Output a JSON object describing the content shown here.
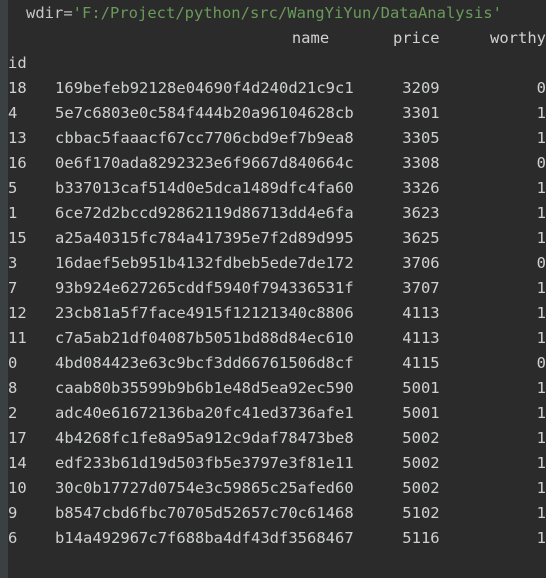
{
  "console": {
    "wdir_line": {
      "var": "wdir",
      "operator": "=",
      "path": "'F:/Project/python/src/WangYiYun/DataAnalysis'"
    },
    "index_name": "id",
    "columns": [
      "name",
      "price",
      "worthy"
    ],
    "rows": [
      {
        "id": "18",
        "name": "169befeb92128e04690f4d240d21c9c1",
        "price": "3209",
        "worthy": "0"
      },
      {
        "id": "4",
        "name": "5e7c6803e0c584f444b20a96104628cb",
        "price": "3301",
        "worthy": "1"
      },
      {
        "id": "13",
        "name": "cbbac5faaacf67cc7706cbd9ef7b9ea8",
        "price": "3305",
        "worthy": "1"
      },
      {
        "id": "16",
        "name": "0e6f170ada8292323e6f9667d840664c",
        "price": "3308",
        "worthy": "0"
      },
      {
        "id": "5",
        "name": "b337013caf514d0e5dca1489dfc4fa60",
        "price": "3326",
        "worthy": "1"
      },
      {
        "id": "1",
        "name": "6ce72d2bccd92862119d86713dd4e6fa",
        "price": "3623",
        "worthy": "1"
      },
      {
        "id": "15",
        "name": "a25a40315fc784a417395e7f2d89d995",
        "price": "3625",
        "worthy": "1"
      },
      {
        "id": "3",
        "name": "16daef5eb951b4132fdbeb5ede7de172",
        "price": "3706",
        "worthy": "0"
      },
      {
        "id": "7",
        "name": "93b924e627265cddf5940f794336531f",
        "price": "3707",
        "worthy": "1"
      },
      {
        "id": "12",
        "name": "23cb81a5f7face4915f12121340c8806",
        "price": "4113",
        "worthy": "1"
      },
      {
        "id": "11",
        "name": "c7a5ab21df04087b5051bd88d84ec610",
        "price": "4113",
        "worthy": "1"
      },
      {
        "id": "0",
        "name": "4bd084423e63c9bcf3dd66761506d8cf",
        "price": "4115",
        "worthy": "0"
      },
      {
        "id": "8",
        "name": "caab80b35599b9b6b1e48d5ea92ec590",
        "price": "5001",
        "worthy": "1"
      },
      {
        "id": "2",
        "name": "adc40e61672136ba20fc41ed3736afe1",
        "price": "5001",
        "worthy": "1"
      },
      {
        "id": "17",
        "name": "4b4268fc1fe8a95a912c9daf78473be8",
        "price": "5002",
        "worthy": "1"
      },
      {
        "id": "14",
        "name": "edf233b61d19d503fb5e3797e3f81e11",
        "price": "5002",
        "worthy": "1"
      },
      {
        "id": "10",
        "name": "30c0b17727d0754e3c59865c25afed60",
        "price": "5002",
        "worthy": "1"
      },
      {
        "id": "9",
        "name": "b8547cbd6fbc70705d52657c70c61468",
        "price": "5102",
        "worthy": "1"
      },
      {
        "id": "6",
        "name": "b14a492967c7f688ba4df43df3568467",
        "price": "5116",
        "worthy": "1"
      }
    ]
  },
  "colors": {
    "background": "#2b2b2b",
    "gutter": "#3b4043",
    "text": "#cfd2d1",
    "string": "#6a9a5b"
  }
}
